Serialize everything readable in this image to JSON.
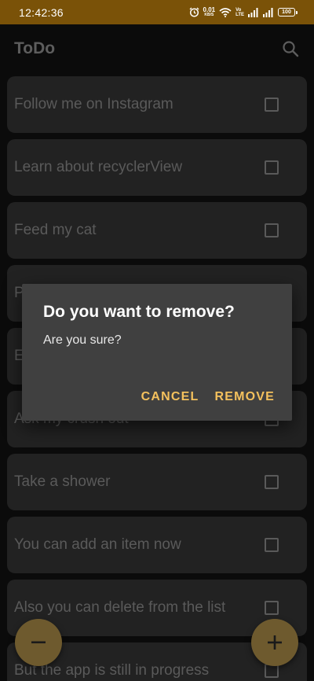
{
  "status_bar": {
    "time": "12:42:36",
    "net_speed_value": "0.01",
    "net_speed_unit": "KB/S",
    "volte_top": "Vo",
    "volte_mid": "LTE",
    "battery": "100",
    "icons": [
      "alarm-icon",
      "wifi-icon",
      "signal-icon",
      "signal-icon",
      "battery-icon"
    ]
  },
  "app_bar": {
    "title": "ToDo",
    "search_icon": "search-icon"
  },
  "todo_items": [
    {
      "label": "Follow me on Instagram",
      "checked": false
    },
    {
      "label": "Learn about recyclerView",
      "checked": false
    },
    {
      "label": "Feed my cat",
      "checked": false
    },
    {
      "label": "P",
      "checked": false
    },
    {
      "label": "E",
      "checked": false
    },
    {
      "label": "Ask my crush out",
      "checked": false
    },
    {
      "label": "Take a shower",
      "checked": false
    },
    {
      "label": "You can add an item now",
      "checked": false
    },
    {
      "label": "Also you can delete from the list",
      "checked": false
    },
    {
      "label": "But the app is still in progress",
      "checked": false
    }
  ],
  "dialog": {
    "title": "Do you want to remove?",
    "message": "Are you sure?",
    "cancel_label": "CANCEL",
    "remove_label": "REMOVE"
  },
  "fabs": {
    "remove_label": "−",
    "add_label": "+"
  },
  "colors": {
    "status_bar": "#7a5208",
    "background": "#0b0b0b",
    "card": "#222222",
    "dialog": "#404040",
    "accent": "#f4c15d",
    "fab": "#6e5a2e"
  }
}
